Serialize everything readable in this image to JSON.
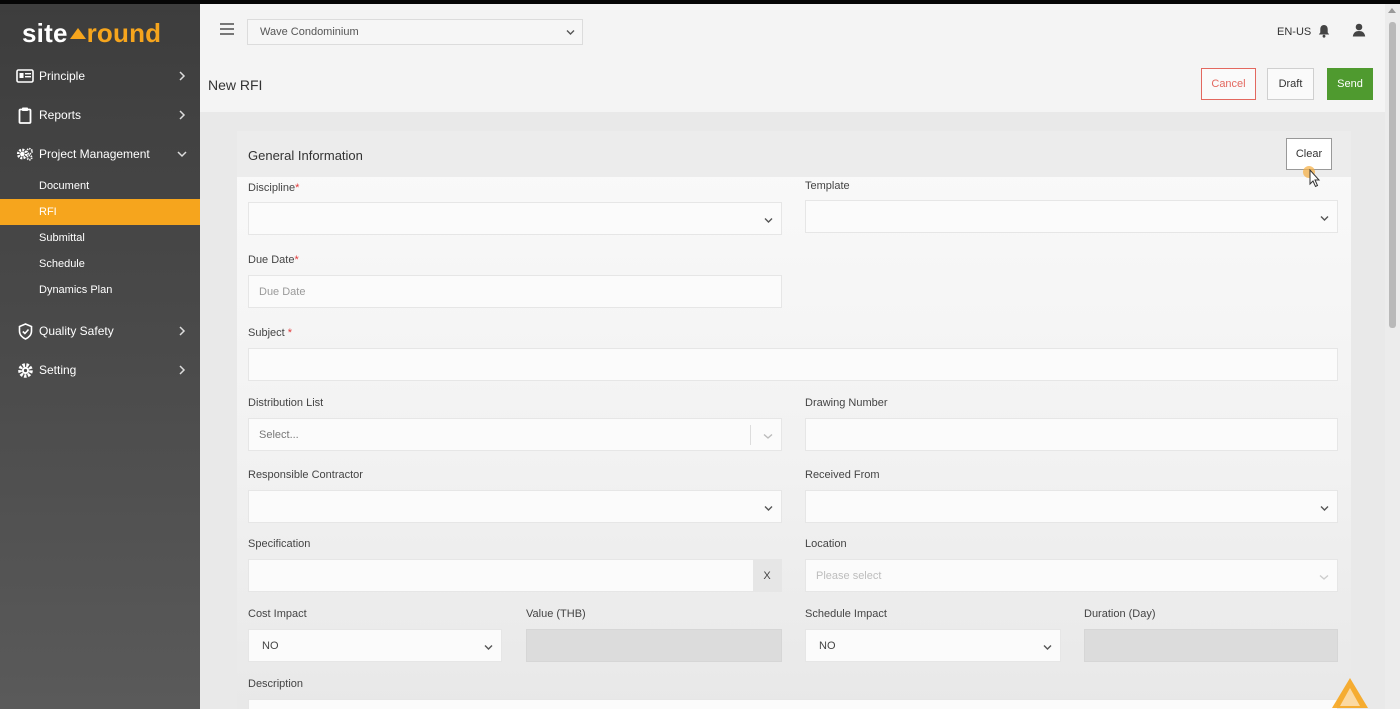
{
  "brand": {
    "part1": "site",
    "part2": "round"
  },
  "sidebar": {
    "items": [
      {
        "label": "Principle",
        "icon": "id-card-icon"
      },
      {
        "label": "Reports",
        "icon": "clipboard-icon"
      },
      {
        "label": "Project Management",
        "icon": "gears-icon"
      },
      {
        "label": "Quality Safety",
        "icon": "shield-icon"
      },
      {
        "label": "Setting",
        "icon": "gear-icon"
      }
    ],
    "subitems": [
      "Document",
      "RFI",
      "Submittal",
      "Schedule",
      "Dynamics Plan"
    ],
    "active_subitem": "RFI"
  },
  "header": {
    "project": "Wave Condominium",
    "language": "EN-US"
  },
  "page": {
    "title": "New RFI"
  },
  "actions": {
    "cancel": "Cancel",
    "draft": "Draft",
    "send": "Send"
  },
  "form": {
    "section_title": "General Information",
    "clear": "Clear",
    "discipline": {
      "label": "Discipline",
      "required": "*"
    },
    "template": {
      "label": "Template"
    },
    "due_date": {
      "label": "Due Date",
      "required": "*",
      "placeholder": "Due Date"
    },
    "subject": {
      "label": "Subject ",
      "required": "*"
    },
    "distribution_list": {
      "label": "Distribution List",
      "placeholder": "Select..."
    },
    "drawing_number": {
      "label": "Drawing Number"
    },
    "responsible_contractor": {
      "label": "Responsible Contractor"
    },
    "received_from": {
      "label": "Received From"
    },
    "specification": {
      "label": "Specification",
      "clear": "X"
    },
    "location": {
      "label": "Location",
      "placeholder": "Please select"
    },
    "cost_impact": {
      "label": "Cost Impact",
      "value": "NO"
    },
    "value_thb": {
      "label": "Value (THB)"
    },
    "schedule_impact": {
      "label": "Schedule Impact",
      "value": "NO"
    },
    "duration": {
      "label": "Duration (Day)"
    },
    "description": {
      "label": "Description"
    }
  },
  "colors": {
    "accent": "#f6a51d",
    "send": "#4f9a2f",
    "cancel": "#e3685f",
    "sidebar": "#454545"
  }
}
